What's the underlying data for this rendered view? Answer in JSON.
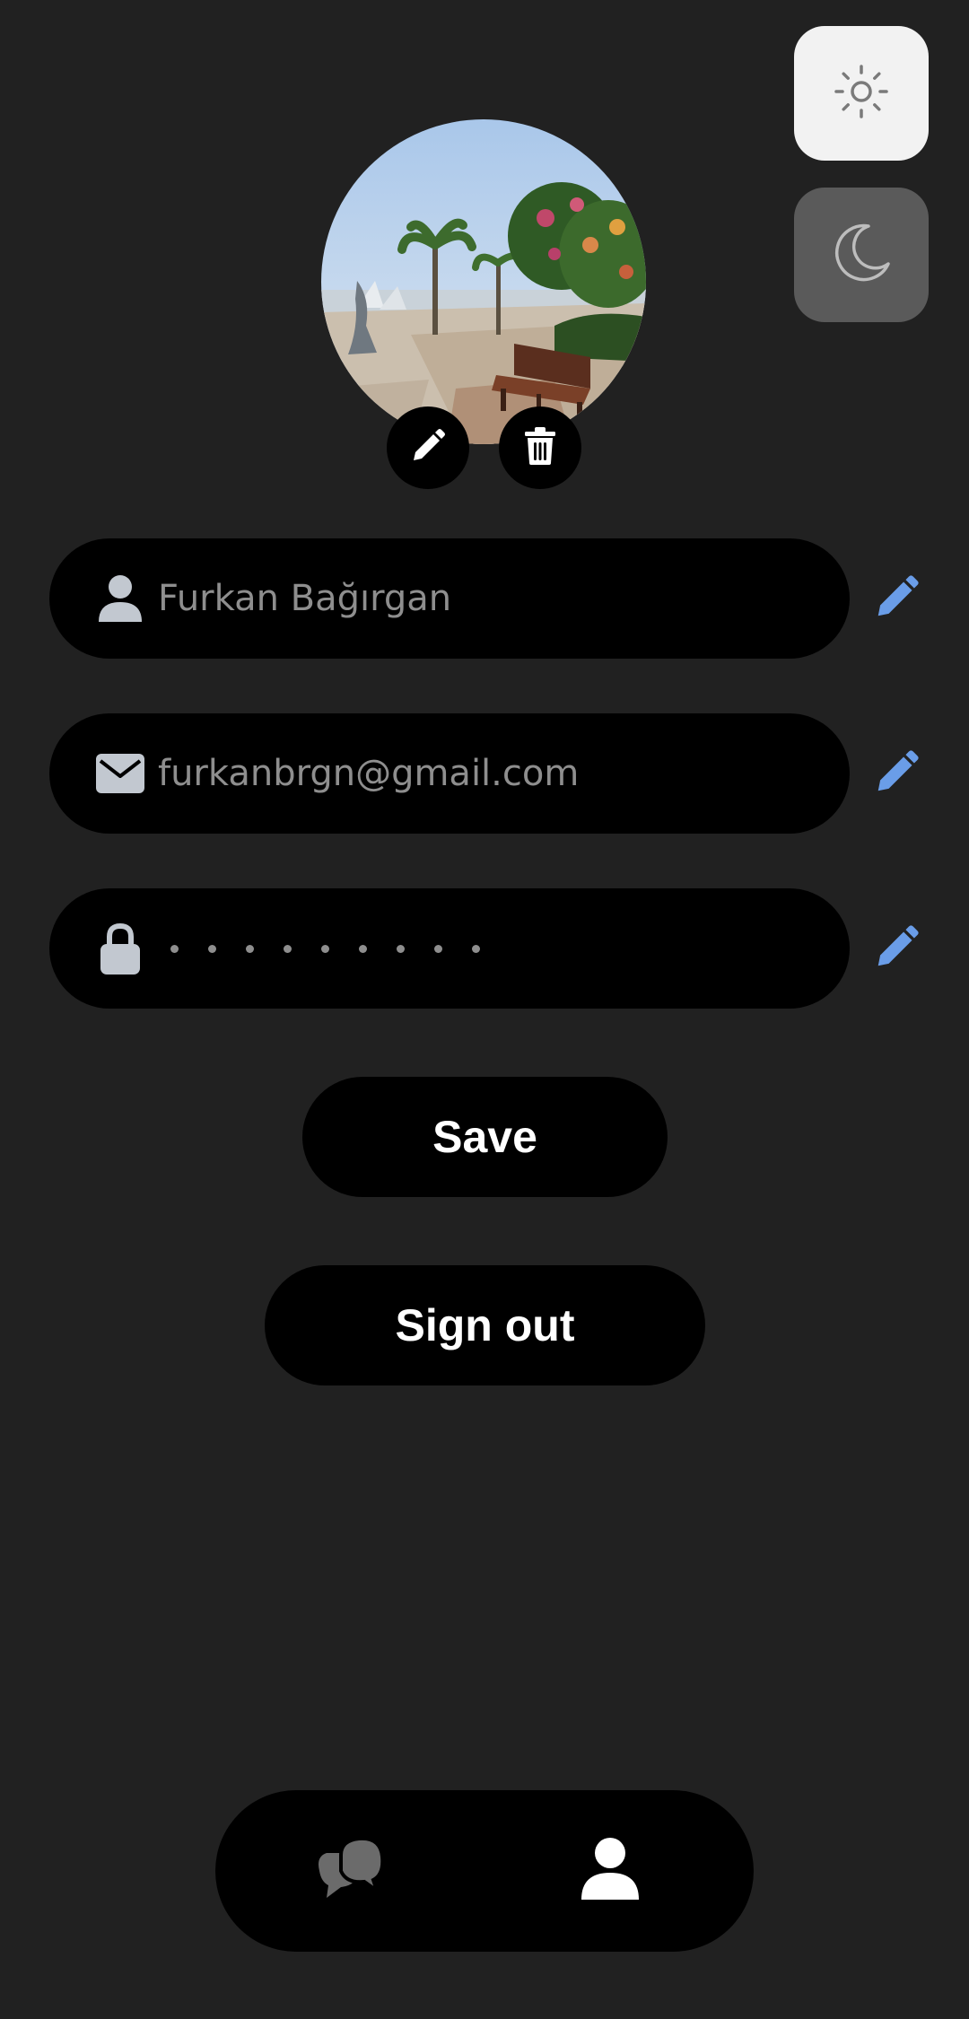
{
  "theme": {
    "light_icon": "sun-icon",
    "dark_icon": "moon-icon",
    "selected": "light"
  },
  "profile": {
    "avatar_alt": "Profile photo",
    "edit_photo_icon": "pencil-icon",
    "delete_photo_icon": "trash-icon"
  },
  "fields": {
    "name": {
      "icon": "person-icon",
      "value": "Furkan Bağırgan"
    },
    "email": {
      "icon": "envelope-icon",
      "value": "furkanbrgn@gmail.com"
    },
    "password": {
      "icon": "lock-icon",
      "masked_length": 9
    }
  },
  "edit_icon": "pencil-icon",
  "buttons": {
    "save": "Save",
    "sign_out": "Sign out"
  },
  "bottom_nav": {
    "items": [
      {
        "name": "chats",
        "icon": "chat-bubbles-icon",
        "active": false
      },
      {
        "name": "profile",
        "icon": "person-icon",
        "active": true
      }
    ]
  },
  "colors": {
    "background": "#212121",
    "surface": "#000000",
    "accent": "#6a9de8",
    "placeholder": "#8e8e8e",
    "icon_muted": "#c2c8d0",
    "inactive_nav": "#6b6b6b"
  }
}
